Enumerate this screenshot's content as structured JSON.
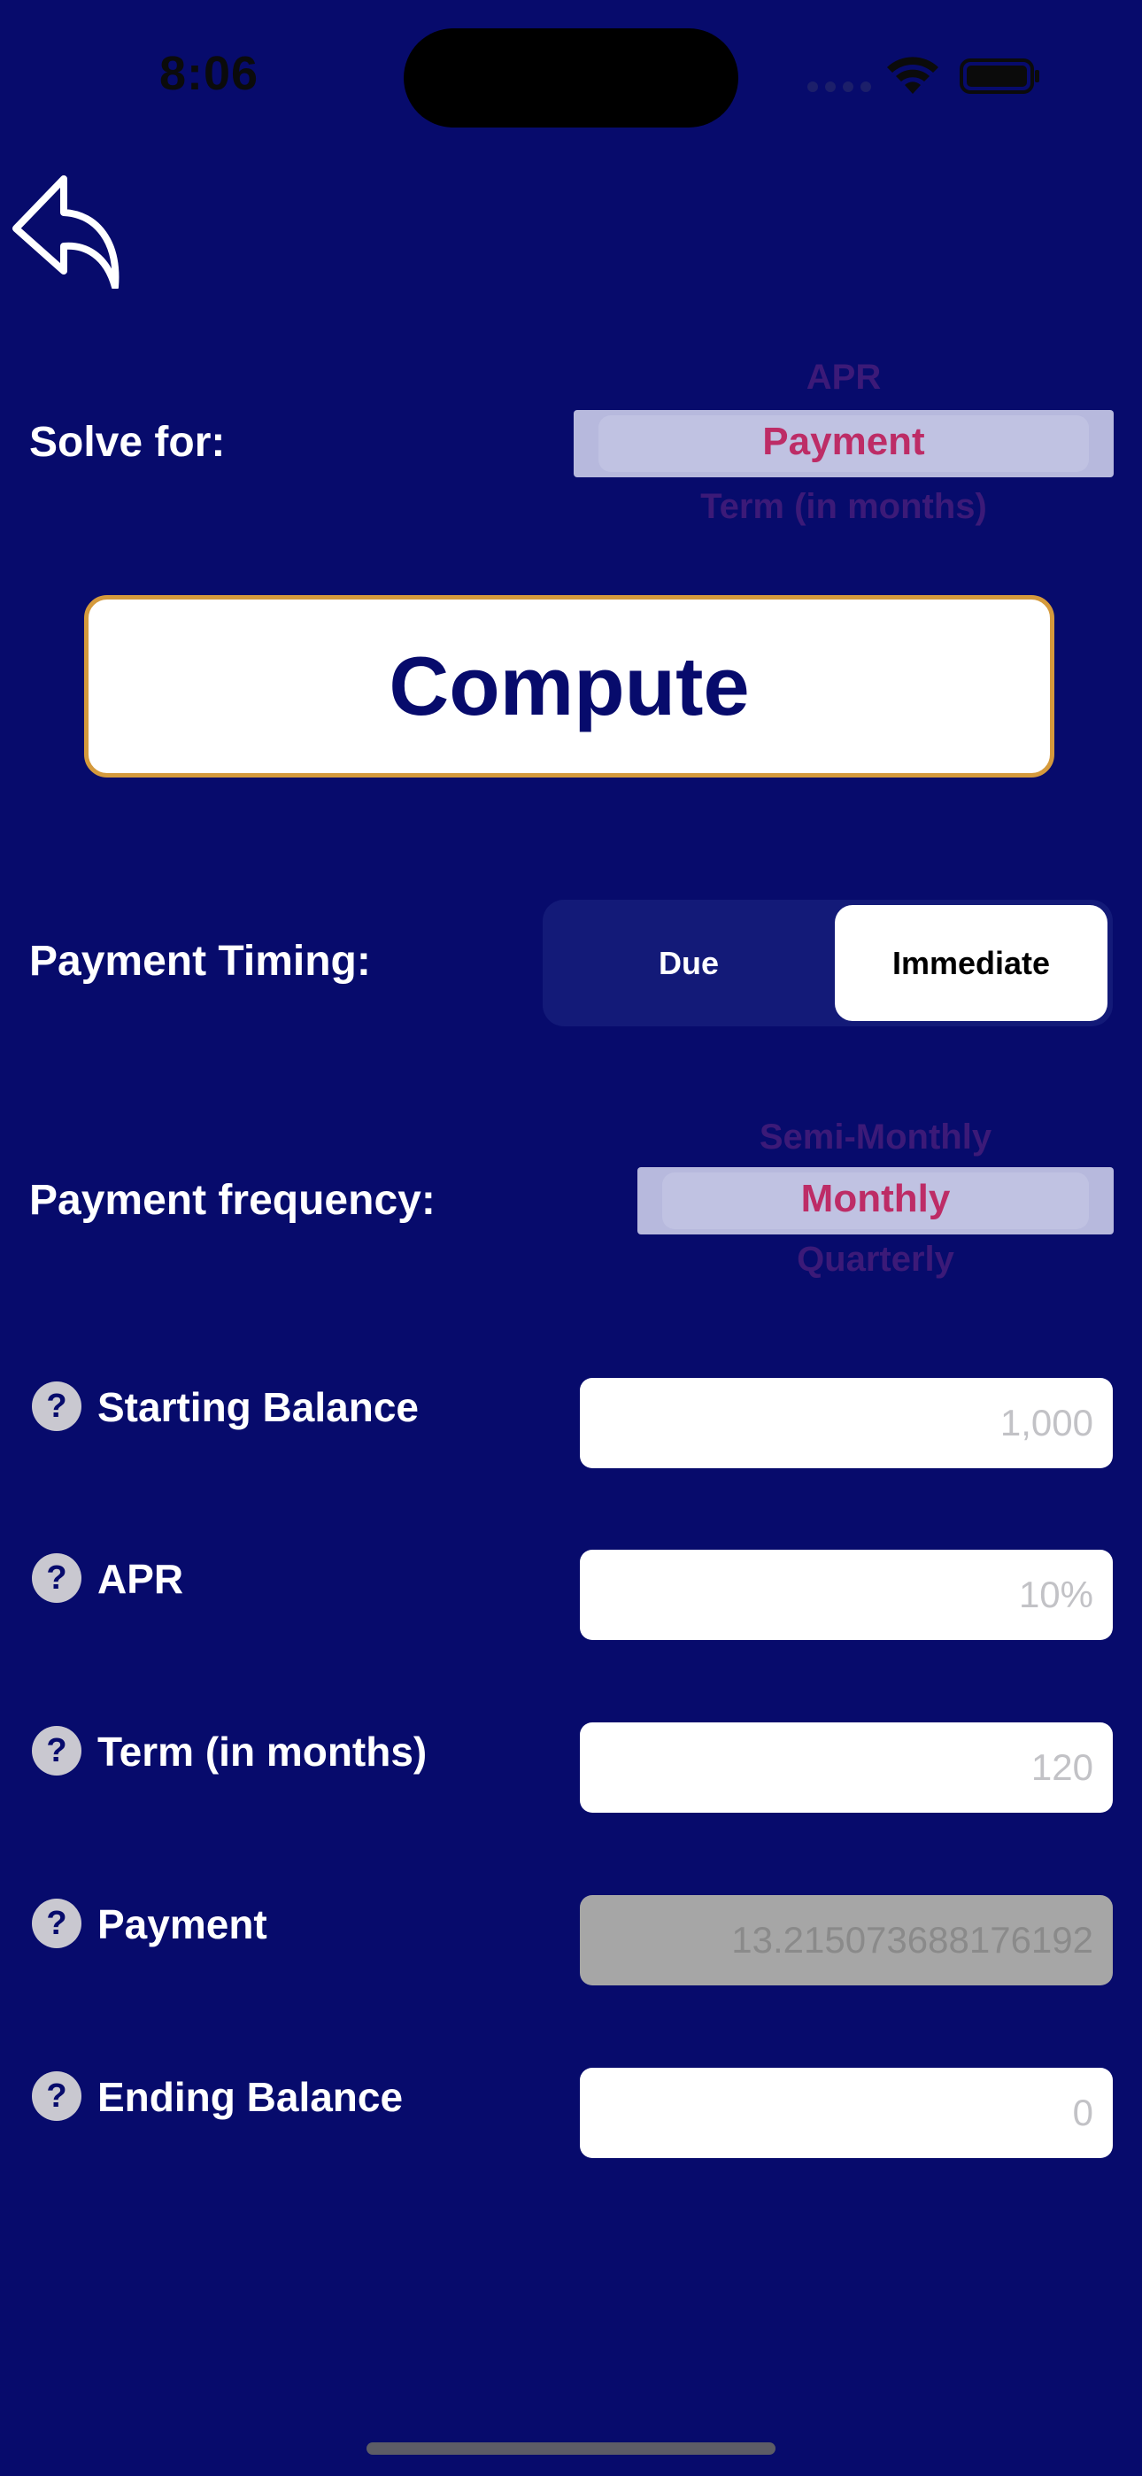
{
  "status_bar": {
    "time": "8:06"
  },
  "header": {
    "back_icon": "reply-arrow-icon"
  },
  "solve_for": {
    "label": "Solve for:",
    "options_above": [
      "APR"
    ],
    "selected": "Payment",
    "options_below": [
      "Term (in months)"
    ]
  },
  "compute": {
    "label": "Compute"
  },
  "payment_timing": {
    "label": "Payment Timing:",
    "options": [
      "Due",
      "Immediate"
    ],
    "selected": "Immediate"
  },
  "payment_frequency": {
    "label": "Payment frequency:",
    "options_above": [
      "Semi-Monthly"
    ],
    "selected": "Monthly",
    "options_below": [
      "Quarterly"
    ]
  },
  "fields": [
    {
      "label": "Starting Balance",
      "placeholder": "1,000",
      "help_icon": "question-icon",
      "editable": true
    },
    {
      "label": "APR",
      "placeholder": "10%",
      "help_icon": "question-icon",
      "editable": true
    },
    {
      "label": "Term (in months)",
      "placeholder": "120",
      "help_icon": "question-icon",
      "editable": true
    },
    {
      "label": "Payment",
      "placeholder": "13.215073688176192",
      "help_icon": "question-icon",
      "editable": false
    },
    {
      "label": "Ending Balance",
      "placeholder": "0",
      "help_icon": "question-icon",
      "editable": true
    }
  ],
  "help_glyph": "?",
  "colors": {
    "background": "#070b6c",
    "picker_selected_text": "#bd2c66",
    "compute_border": "#d59a3c"
  }
}
